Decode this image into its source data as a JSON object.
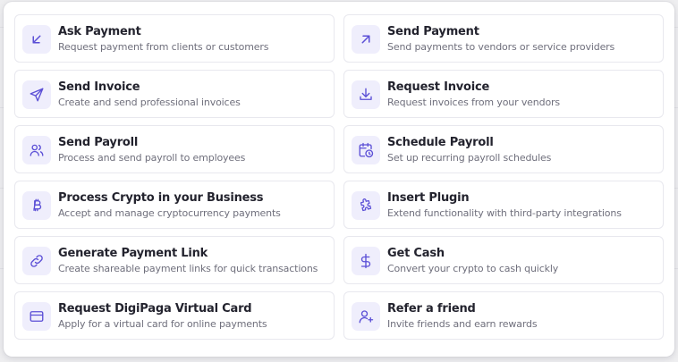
{
  "accent": "#5b4fd6",
  "actions": [
    {
      "icon": "arrow-down-left-icon",
      "title": "Ask Payment",
      "desc": "Request payment from clients or customers"
    },
    {
      "icon": "arrow-up-right-icon",
      "title": "Send Payment",
      "desc": "Send payments to vendors or service providers"
    },
    {
      "icon": "send-icon",
      "title": "Send Invoice",
      "desc": "Create and send professional invoices"
    },
    {
      "icon": "download-icon",
      "title": "Request Invoice",
      "desc": "Request invoices from your vendors"
    },
    {
      "icon": "users-icon",
      "title": "Send Payroll",
      "desc": "Process and send payroll to employees"
    },
    {
      "icon": "calendar-clock-icon",
      "title": "Schedule Payroll",
      "desc": "Set up recurring payroll schedules"
    },
    {
      "icon": "bitcoin-icon",
      "title": "Process Crypto in your Business",
      "desc": "Accept and manage cryptocurrency payments"
    },
    {
      "icon": "puzzle-icon",
      "title": "Insert Plugin",
      "desc": "Extend functionality with third-party integrations"
    },
    {
      "icon": "link-icon",
      "title": "Generate Payment Link",
      "desc": "Create shareable payment links for quick transactions"
    },
    {
      "icon": "dollar-icon",
      "title": "Get Cash",
      "desc": "Convert your crypto to cash quickly"
    },
    {
      "icon": "credit-card-icon",
      "title": "Request DigiPaga Virtual Card",
      "desc": "Apply for a virtual card for online payments"
    },
    {
      "icon": "user-plus-icon",
      "title": "Refer a friend",
      "desc": "Invite friends and earn rewards"
    }
  ]
}
